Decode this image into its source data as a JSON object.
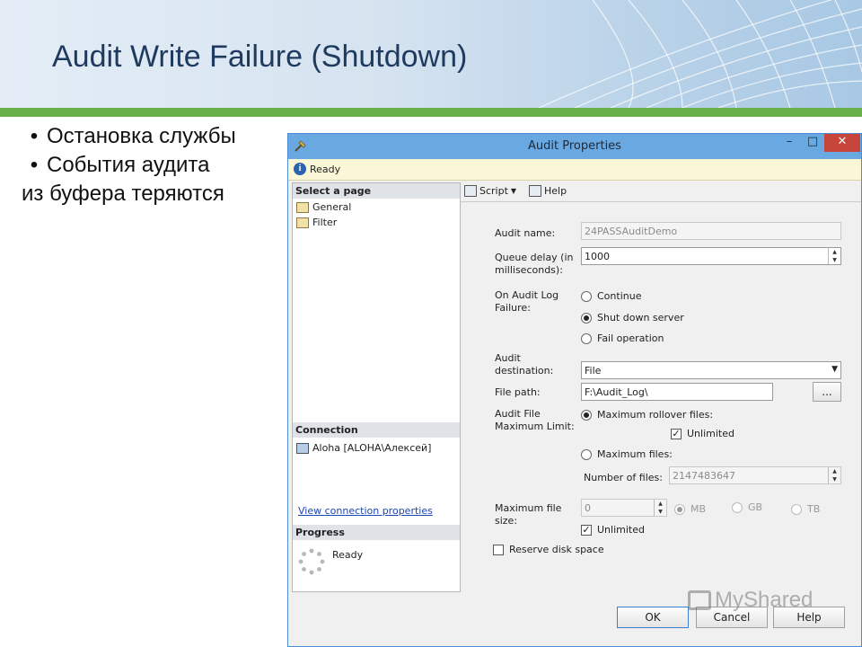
{
  "slide": {
    "title": "Audit Write Failure (Shutdown)",
    "bullets": [
      "Остановка службы",
      "События аудита"
    ],
    "continuation": "из буфера теряются"
  },
  "dialog": {
    "title": "Audit Properties",
    "status": "Ready",
    "select_page_header": "Select a page",
    "pages": [
      "General",
      "Filter"
    ],
    "connection_header": "Connection",
    "connection": "Aloha [ALOHA\\Алексей]",
    "view_connection_link": "View connection properties",
    "progress_header": "Progress",
    "progress_status": "Ready",
    "toolbar": {
      "script": "Script",
      "help": "Help"
    },
    "form": {
      "audit_name_label": "Audit name:",
      "audit_name_value": "24PASSAuditDemo",
      "queue_delay_label_1": "Queue delay (in",
      "queue_delay_label_2": "milliseconds):",
      "queue_delay_value": "1000",
      "on_failure_label_1": "On Audit Log",
      "on_failure_label_2": "Failure:",
      "failure_options": [
        "Continue",
        "Shut down server",
        "Fail operation"
      ],
      "failure_selected": "Shut down server",
      "destination_label_1": "Audit",
      "destination_label_2": "destination:",
      "destination_value": "File",
      "file_path_label": "File path:",
      "file_path_value": "F:\\Audit_Log\\",
      "browse_label": "...",
      "max_limit_label_1": "Audit File",
      "max_limit_label_2": "Maximum Limit:",
      "max_rollover_label": "Maximum rollover files:",
      "unlimited_label": "Unlimited",
      "max_files_label": "Maximum files:",
      "number_of_files_label": "Number of files:",
      "number_of_files_value": "2147483647",
      "max_file_size_label_1": "Maximum file",
      "max_file_size_label_2": "size:",
      "max_file_size_value": "0",
      "size_units": [
        "MB",
        "GB",
        "TB"
      ],
      "size_unlimited_label": "Unlimited",
      "reserve_label": "Reserve disk space"
    },
    "buttons": {
      "ok": "OK",
      "cancel": "Cancel",
      "help": "Help"
    }
  },
  "watermark": "MyShared",
  "colors": {
    "title": "#1f3a5f",
    "accent_green": "#6ab04a",
    "titlebar": "#6aa8e2",
    "close": "#c7453b",
    "link": "#1c46b3"
  }
}
